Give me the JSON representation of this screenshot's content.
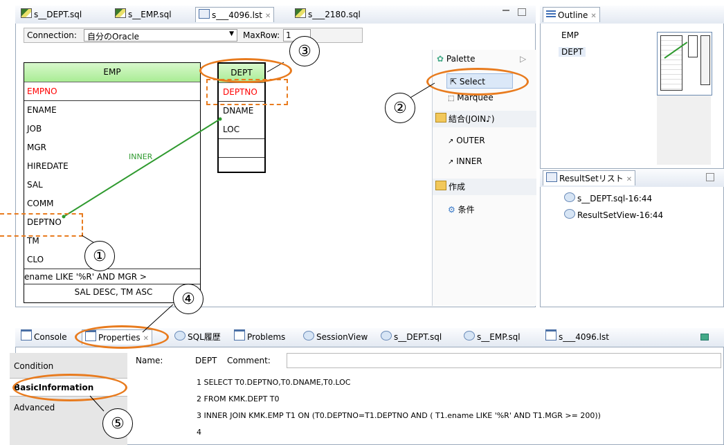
{
  "editor_tabs": [
    {
      "label": "s__DEPT.sql"
    },
    {
      "label": "s__EMP.sql"
    },
    {
      "label": "s___4096.lst"
    },
    {
      "label": "s___2180.sql"
    }
  ],
  "connection": {
    "label": "Connection:",
    "value": "自分のOracle",
    "maxrow_label": "MaxRow:",
    "maxrow_value": "1"
  },
  "emp_table": {
    "title": "EMP",
    "columns": [
      "EMPNO",
      "ENAME",
      "JOB",
      "MGR",
      "HIREDATE",
      "SAL",
      "COMM",
      "DEPTNO",
      "TM",
      "CLO"
    ],
    "condition": "ename LIKE '%R' AND MGR >",
    "order": "SAL DESC, TM ASC"
  },
  "dept_table": {
    "title": "DEPT",
    "columns": [
      "DEPTNO",
      "DNAME",
      "LOC"
    ]
  },
  "join_label": "INNER",
  "palette": {
    "title": "Palette",
    "select": "Select",
    "marquee": "Marquee",
    "join_group": "結合(JOIN♪)",
    "outer": "OUTER",
    "inner": "INNER",
    "create_group": "作成",
    "condition": "条件"
  },
  "outline": {
    "title": "Outline",
    "items": [
      "EMP",
      "DEPT"
    ]
  },
  "resultset": {
    "title": "ResultSetリスト",
    "items": [
      "s__DEPT.sql-16:44",
      "ResultSetView-16:44"
    ]
  },
  "bottom_tabs": [
    "Console",
    "Properties",
    "SQL履歴",
    "Problems",
    "SessionView",
    "s__DEPT.sql",
    "s__EMP.sql",
    "s___4096.lst"
  ],
  "properties": {
    "side_tabs": [
      "Condition",
      "BasicInformation",
      "Advanced"
    ],
    "name_label": "Name:",
    "name_value": "DEPT",
    "comment_label": "Comment:",
    "sql_lines": [
      "1 SELECT T0.DEPTNO,T0.DNAME,T0.LOC",
      "2 FROM KMK.DEPT T0",
      "3  INNER JOIN KMK.EMP T1 ON (T0.DEPTNO=T1.DEPTNO AND ( T1.ename LIKE '%R' AND T1.MGR >= 200))",
      "4"
    ]
  },
  "callouts": [
    "①",
    "②",
    "③",
    "④",
    "⑤"
  ],
  "colors": {
    "accent": "#e87b1e",
    "pk": "#ff0000",
    "link": "#2f9a2f",
    "header_green": "#b6f0a6"
  }
}
